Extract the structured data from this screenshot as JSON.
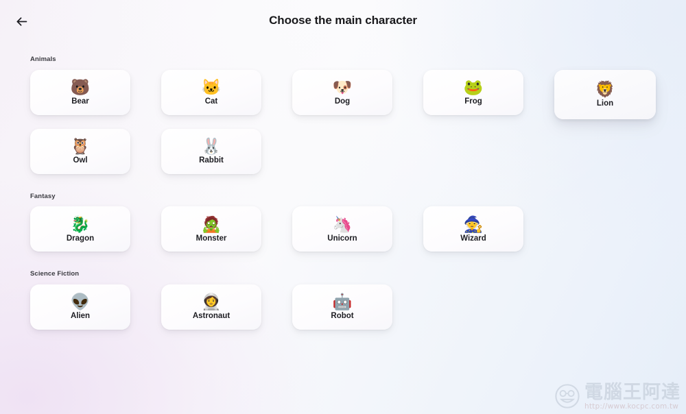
{
  "header": {
    "title": "Choose the main character",
    "back_icon": "arrow-left-icon",
    "back_label": "Back"
  },
  "sections": [
    {
      "id": "animals",
      "title": "Animals",
      "cards": [
        {
          "label": "Bear",
          "emoji": "🐻",
          "icon_name": "bear-emoji",
          "hovered": false
        },
        {
          "label": "Cat",
          "emoji": "🐱",
          "icon_name": "cat-emoji",
          "hovered": false
        },
        {
          "label": "Dog",
          "emoji": "🐶",
          "icon_name": "dog-emoji",
          "hovered": false
        },
        {
          "label": "Frog",
          "emoji": "🐸",
          "icon_name": "frog-emoji",
          "hovered": false
        },
        {
          "label": "Lion",
          "emoji": "🦁",
          "icon_name": "lion-emoji",
          "hovered": true
        },
        {
          "label": "Owl",
          "emoji": "🦉",
          "icon_name": "owl-emoji",
          "hovered": false
        },
        {
          "label": "Rabbit",
          "emoji": "🐰",
          "icon_name": "rabbit-emoji",
          "hovered": false
        }
      ]
    },
    {
      "id": "fantasy",
      "title": "Fantasy",
      "cards": [
        {
          "label": "Dragon",
          "emoji": "🐉",
          "icon_name": "dragon-emoji",
          "hovered": false
        },
        {
          "label": "Monster",
          "emoji": "🧟",
          "icon_name": "monster-emoji",
          "hovered": false
        },
        {
          "label": "Unicorn",
          "emoji": "🦄",
          "icon_name": "unicorn-emoji",
          "hovered": false
        },
        {
          "label": "Wizard",
          "emoji": "🧙",
          "icon_name": "wizard-emoji",
          "hovered": false
        }
      ]
    },
    {
      "id": "science-fiction",
      "title": "Science Fiction",
      "cards": [
        {
          "label": "Alien",
          "emoji": "👽",
          "icon_name": "alien-emoji",
          "hovered": false
        },
        {
          "label": "Astronaut",
          "emoji": "👩‍🚀",
          "icon_name": "astronaut-emoji",
          "hovered": false
        },
        {
          "label": "Robot",
          "emoji": "🤖",
          "icon_name": "robot-emoji",
          "hovered": false
        }
      ]
    }
  ],
  "watermark": {
    "name": "電腦王阿達",
    "url": "http://www.kocpc.com.tw"
  },
  "colors": {
    "title_text": "#18181b",
    "section_text": "#3a3a40",
    "card_bg": "#ffffff",
    "bg_left": "#efe2f4",
    "bg_right": "#e6eef9",
    "watermark_text": "#b8c2cf",
    "watermark_url": "#c4a6aa"
  }
}
